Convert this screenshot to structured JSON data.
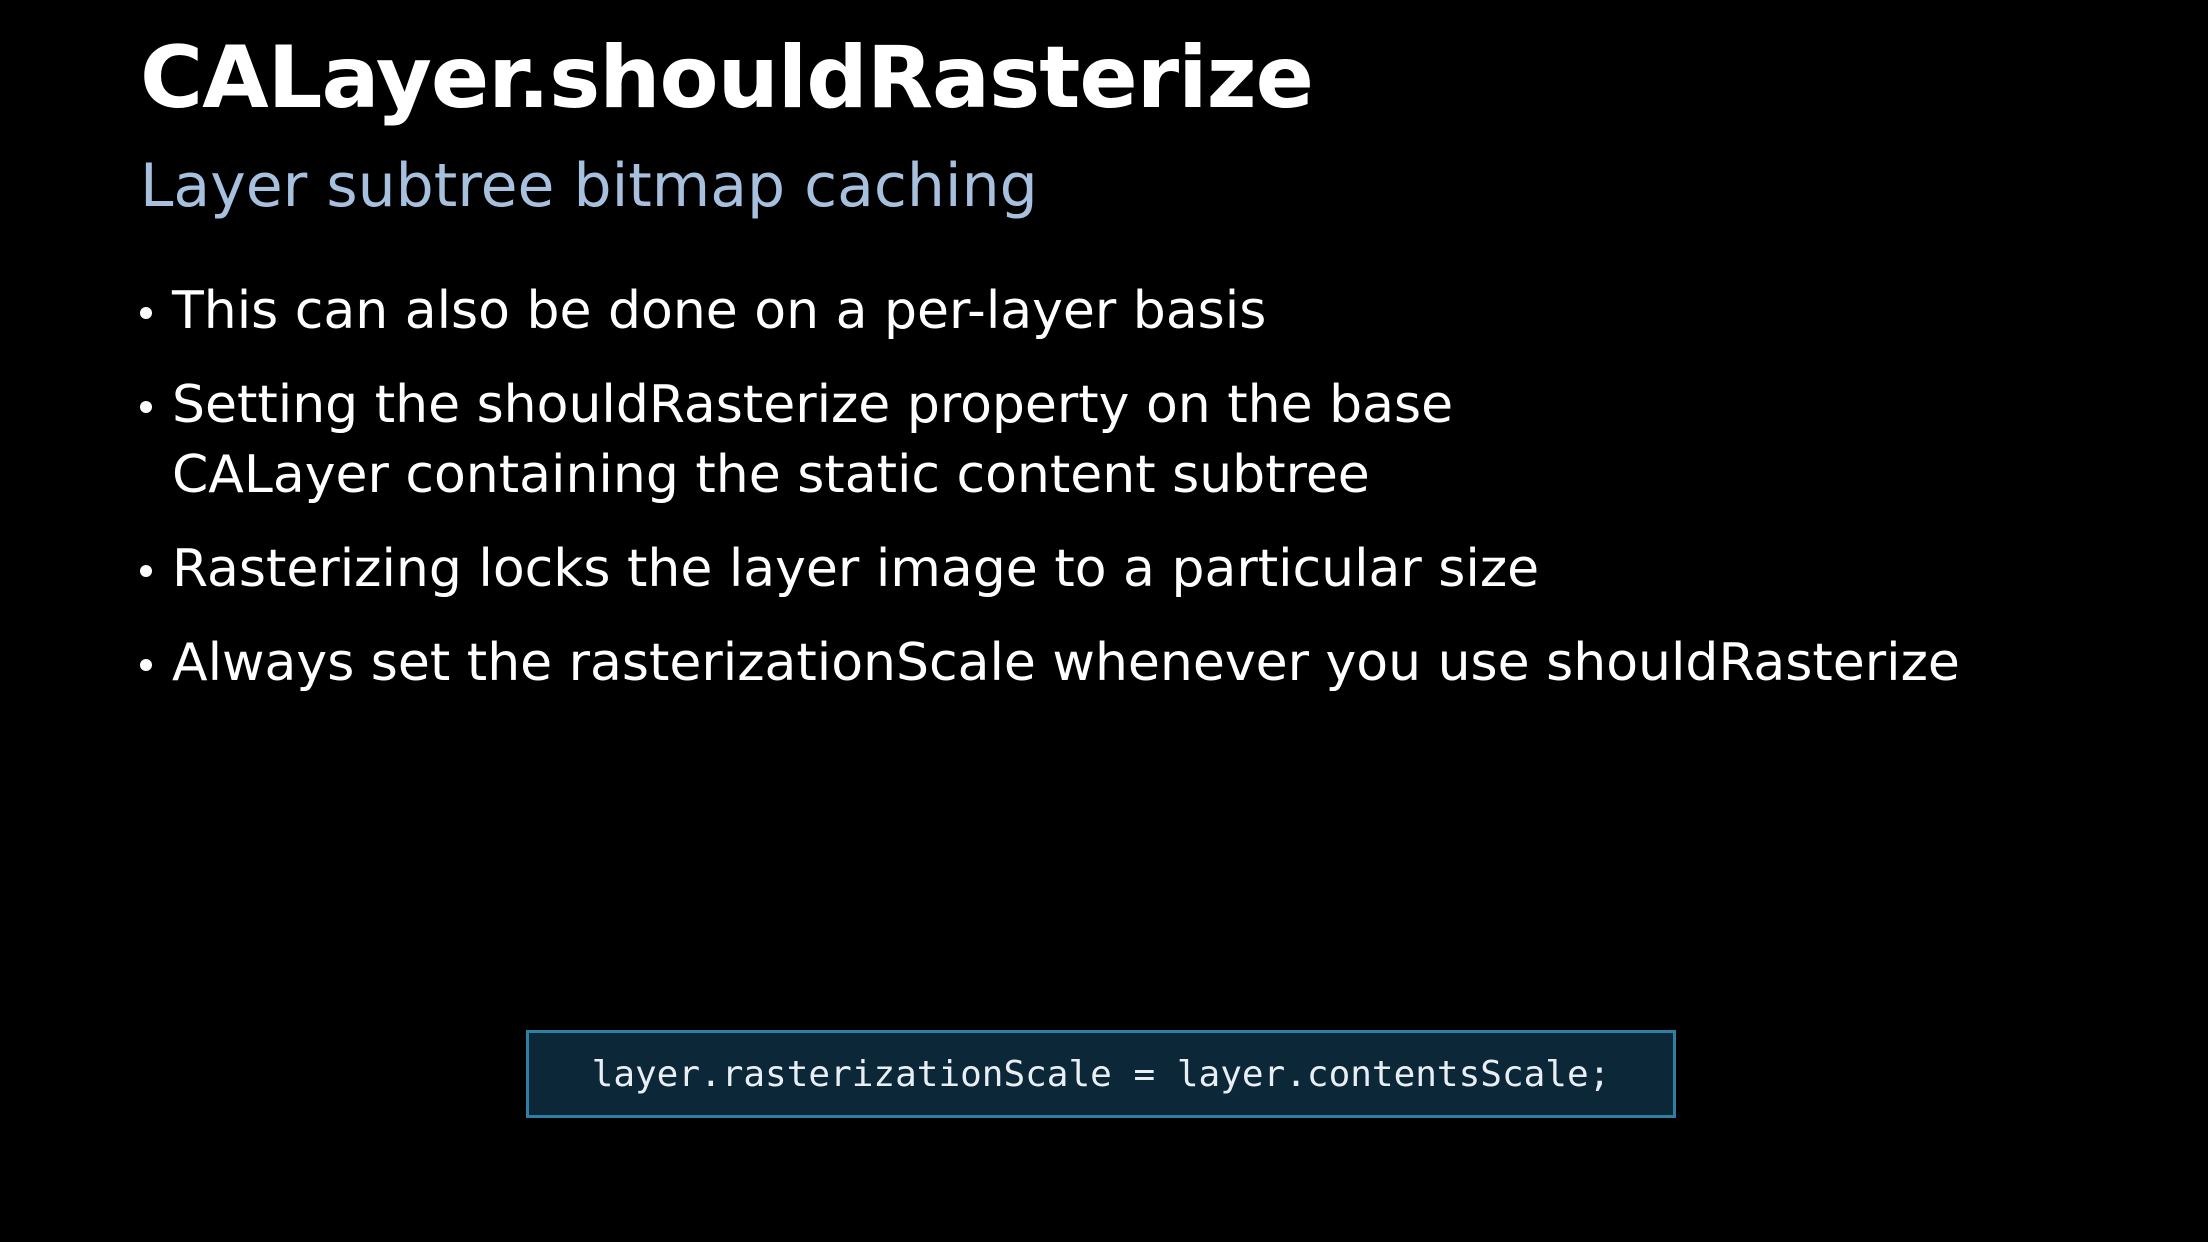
{
  "slide": {
    "title": "CALayer.shouldRasterize",
    "subtitle": "Layer subtree bitmap caching",
    "bullets": [
      {
        "lines": [
          "This can also be done on a per-layer basis"
        ]
      },
      {
        "lines": [
          "Setting the shouldRasterize property on the base",
          "CALayer containing the static content subtree"
        ]
      },
      {
        "lines": [
          "Rasterizing locks the layer image to a particular size"
        ]
      },
      {
        "lines": [
          "Always set the rasterizationScale whenever you use shouldRasterize"
        ]
      }
    ],
    "code": "layer.rasterizationScale = layer.contentsScale;"
  },
  "colors": {
    "background": "#000000",
    "title": "#ffffff",
    "subtitle": "#a6c0dd",
    "code_border": "#2f7fa3",
    "code_background": "#0c2838"
  }
}
